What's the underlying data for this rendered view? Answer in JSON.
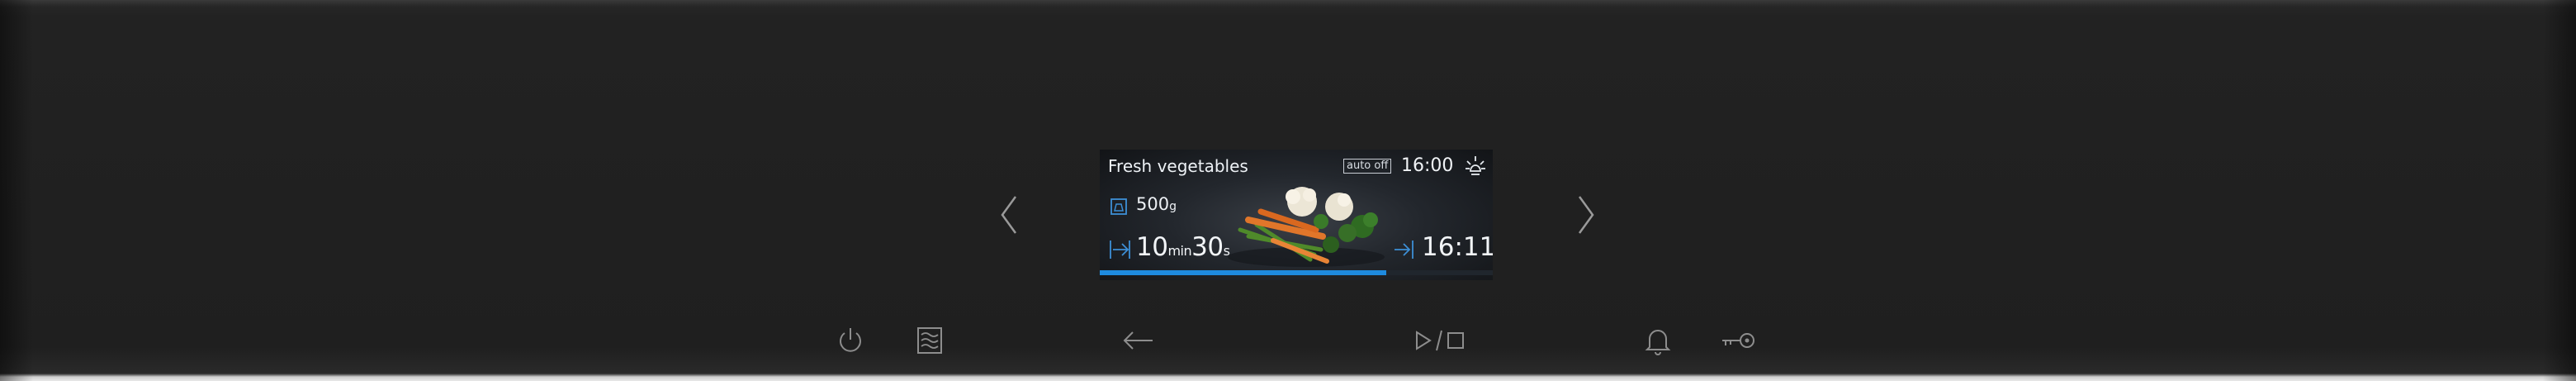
{
  "screen": {
    "dish_title": "Fresh vegetables",
    "auto_off_label": "auto off",
    "clock_time": "16:00",
    "weight_value": "500",
    "weight_unit": "g",
    "duration_min": "10",
    "duration_min_unit": "min",
    "duration_sec": "30",
    "duration_sec_unit": "s",
    "end_time": "16:11",
    "progress_fraction": 0.73
  },
  "colors": {
    "accent": "#1e8be0",
    "text": "#eef2f6",
    "panel": "#1f1f1f",
    "icon": "#8d8d8d"
  },
  "icons": {
    "left": "chevron-left-icon",
    "right": "chevron-right-icon",
    "power": "power-icon",
    "steam": "steam-mode-icon",
    "back": "back-arrow-icon",
    "play_stop": "play-stop-icon",
    "alarm": "bell-icon",
    "key": "key-lock-icon"
  }
}
